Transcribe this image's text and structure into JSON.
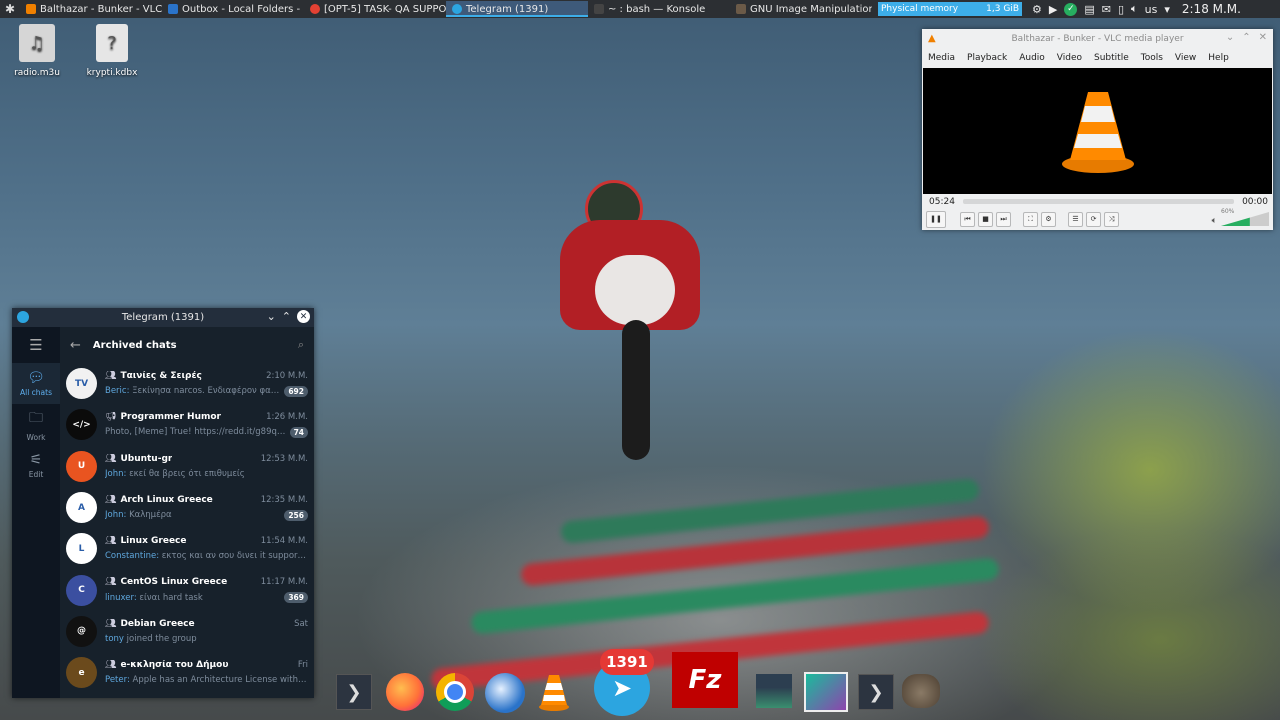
{
  "panel": {
    "tasks": [
      {
        "label": "Balthazar - Bunker - VLC me...",
        "icon_color": "#f08000",
        "active": false
      },
      {
        "label": "Outbox - Local Folders - Moz...",
        "icon_color": "#2a73c9",
        "active": false
      },
      {
        "label": "[OPT-5] TASK- QA SUPPORT ...",
        "icon_color": "#e34133",
        "active": false
      },
      {
        "label": "Telegram (1391)",
        "icon_color": "#2ca5e0",
        "active": true
      },
      {
        "label": "~ : bash — Konsole",
        "icon_color": "#444",
        "active": false
      },
      {
        "label": "GNU Image Manipulation Pr...",
        "icon_color": "#6b5a48",
        "active": false
      }
    ],
    "memory_label": "Physical memory",
    "memory_value": "1,3 GiB",
    "keyboard_layout": "us",
    "clock": "2:18 Μ.Μ."
  },
  "desktop": {
    "icons": [
      {
        "label": "radio.m3u"
      },
      {
        "label": "krypti.kdbx"
      }
    ]
  },
  "telegram": {
    "window_title": "Telegram (1391)",
    "header_title": "Archived chats",
    "folders": [
      {
        "label": "All chats"
      },
      {
        "label": "Work"
      },
      {
        "label": "Edit"
      }
    ],
    "chats": [
      {
        "name": "Ταινίες & Σειρές",
        "time": "2:10 Μ.Μ.",
        "sender": "Beric:",
        "message": "Ξεκίνησα narcos. Ενδιαφέρον φαίνε...",
        "badge": "692",
        "avatar_text": "TV",
        "avatar_color": "#f1f1f1"
      },
      {
        "name": "Programmer Humor",
        "time": "1:26 Μ.Μ.",
        "sender": "",
        "message": "Photo, [Meme] True! https://redd.it/g89qie ...",
        "badge": "74",
        "avatar_text": "</>",
        "avatar_color": "#0b0b0b"
      },
      {
        "name": "Ubuntu-gr",
        "time": "12:53 Μ.Μ.",
        "sender": "John:",
        "message": "εκεί θα βρεις ότι επιθυμείς",
        "badge": "",
        "avatar_text": "U",
        "avatar_color": "#e95420"
      },
      {
        "name": "Arch Linux Greece",
        "time": "12:35 Μ.Μ.",
        "sender": "John:",
        "message": "Καλημέρα",
        "badge": "256",
        "avatar_text": "A",
        "avatar_color": "#ffffff"
      },
      {
        "name": "Linux Greece",
        "time": "11:54 Μ.Μ.",
        "sender": "Constantine:",
        "message": "εκτος και αν σου δινει it support σ...",
        "badge": "",
        "avatar_text": "L",
        "avatar_color": "#ffffff"
      },
      {
        "name": "CentOS Linux Greece",
        "time": "11:17 Μ.Μ.",
        "sender": "linuxer:",
        "message": "είναι hard task",
        "badge": "369",
        "avatar_text": "C",
        "avatar_color": "#3b4fa0"
      },
      {
        "name": "Debian Greece",
        "time": "Sat",
        "sender": "tony",
        "message": "joined the group",
        "badge": "",
        "avatar_text": "@",
        "avatar_color": "#111111"
      },
      {
        "name": "e-κκλησία του Δήμου",
        "time": "Fri",
        "sender": "Peter:",
        "message": "Apple has an Architecture License with AR...",
        "badge": "",
        "avatar_text": "e",
        "avatar_color": "#6b4a1c"
      }
    ]
  },
  "vlc": {
    "window_title": "Balthazar - Bunker - VLC media player",
    "menu": [
      "Media",
      "Playback",
      "Audio",
      "Video",
      "Subtitle",
      "Tools",
      "View",
      "Help"
    ],
    "elapsed": "05:24",
    "remaining": "00:00",
    "volume_label": "60%",
    "volume": 0.6
  },
  "dock": {
    "telegram_badge": "1391",
    "filezilla_label": "Fz",
    "items": [
      "chevron-right",
      "firefox",
      "chrome",
      "thunderbird",
      "vlc",
      "telegram",
      "filezilla",
      "system-monitor",
      "image-viewer",
      "chevron-right",
      "gimp"
    ]
  }
}
